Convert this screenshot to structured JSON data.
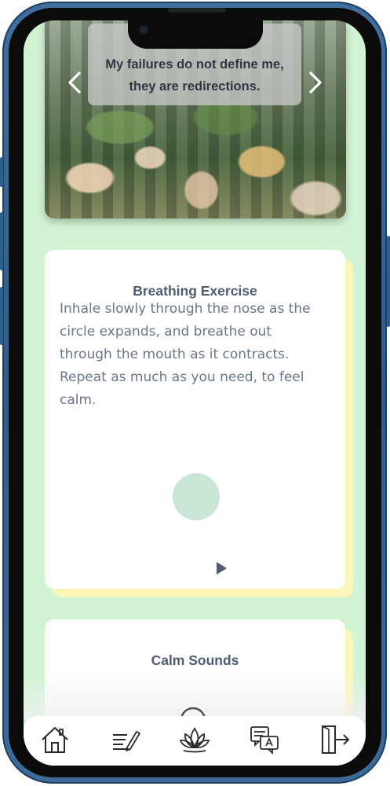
{
  "quote": {
    "text": "My failures do not define me, they are redirections.",
    "prev_icon": "chevron-left-icon",
    "next_icon": "chevron-right-icon"
  },
  "breathing": {
    "title": "Breathing Exercise",
    "body": "Inhale slowly through the nose as the circle expands, and breathe out through the mouth as it contracts. Repeat as much as you need, to feel calm.",
    "play_icon": "play-icon"
  },
  "sounds": {
    "title": "Calm Sounds"
  },
  "nav": {
    "items": [
      {
        "icon": "home-icon"
      },
      {
        "icon": "journal-icon"
      },
      {
        "icon": "lotus-icon"
      },
      {
        "icon": "translate-chat-icon"
      },
      {
        "icon": "logout-icon"
      }
    ]
  },
  "colors": {
    "screen_bg": "#d2f4d4",
    "card_accent": "#fbf6b8",
    "text_dark": "#4f5c74",
    "circle": "#cae6d6",
    "frame": "#2e5d8c"
  }
}
